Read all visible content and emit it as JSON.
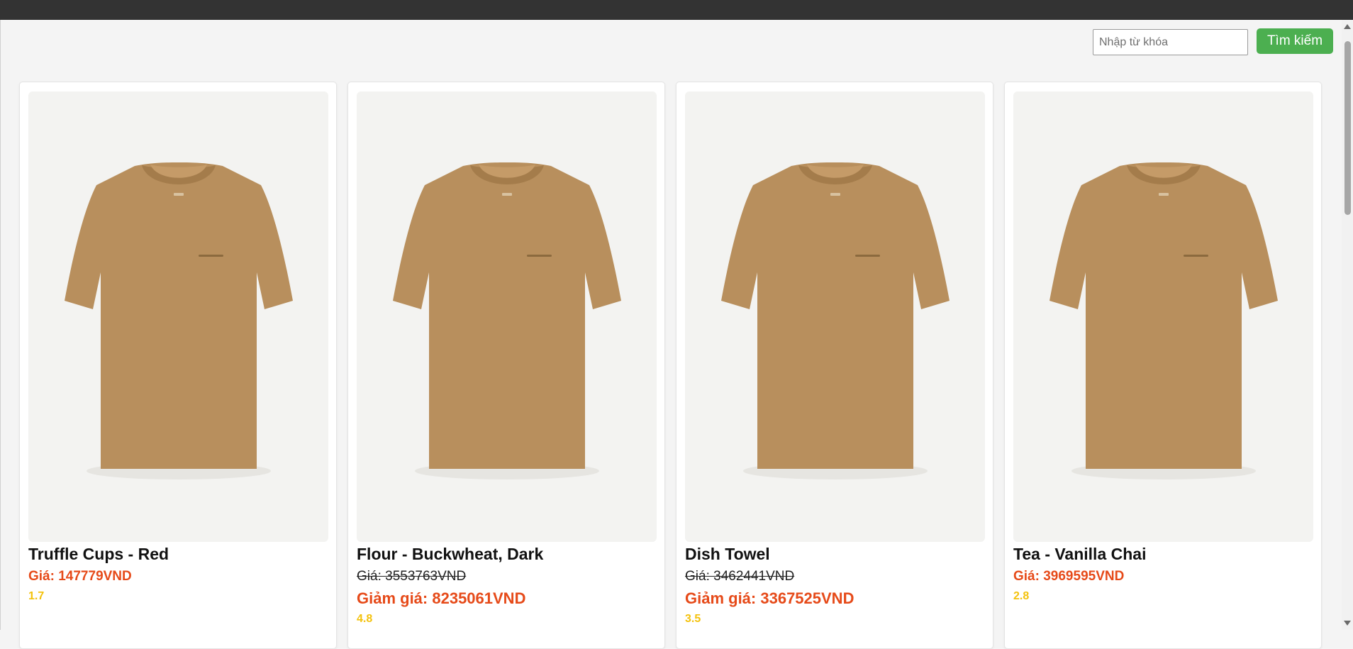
{
  "search": {
    "placeholder": "Nhập từ khóa",
    "button_label": "Tìm kiếm"
  },
  "products": [
    {
      "name": "Truffle Cups - Red",
      "price": "Giá: 147779VND",
      "rating": "1.7"
    },
    {
      "name": "Flour - Buckwheat, Dark",
      "old_price": "Giá: 3553763VND",
      "sale_price": "Giảm giá: 8235061VND",
      "rating": "4.8"
    },
    {
      "name": "Dish Towel",
      "old_price": "Giá: 3462441VND",
      "sale_price": "Giảm giá: 3367525VND",
      "rating": "3.5"
    },
    {
      "name": "Tea - Vanilla Chai",
      "price": "Giá: 3969595VND",
      "rating": "2.8"
    }
  ],
  "colors": {
    "accent_button": "#4caf50",
    "price": "#e64a19",
    "rating": "#f4c20d",
    "shirt": "#b88f5d"
  }
}
